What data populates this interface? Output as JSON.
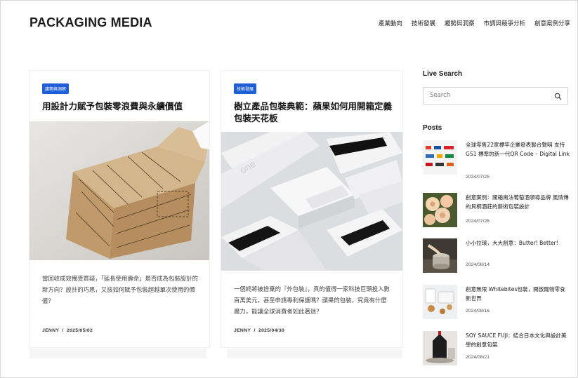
{
  "header": {
    "logo": "PACKAGING MEDIA",
    "nav": [
      "產業動向",
      "技術發展",
      "趨勢與洞察",
      "市調與競爭分析",
      "創意案例分享"
    ]
  },
  "cards": [
    {
      "tag": "趨勢與洞察",
      "title": "用設計力賦予包裝零浪費與永續價值",
      "excerpt": "當回收成效備受質疑，「延長使用壽命」是否成為包裝設計的新方向？設計的巧思，又該如何賦予包裝超越單次使用的價值？",
      "author": "JENNY",
      "date": "2025/05/02"
    },
    {
      "tag": "技術發展",
      "title": "樹立產品包裝典範：蘋果如何用開箱定義包裝天花板",
      "excerpt": "一個終將被捨棄的『外包裝』，真的值得一家科技巨頭投入數百萬美元，甚至申請專利保護嗎？蘋果的包裝，究竟有什麼魔力，能讓全球消費者如此著迷？",
      "author": "JENNY",
      "date": "2025/04/30"
    }
  ],
  "sidebar": {
    "live_search_heading": "Live Search",
    "search_placeholder": "Search",
    "posts_heading": "Posts",
    "posts": [
      {
        "title": "全球零售22家標竿企業發表聯合聲明 支持GS1 標準的新一代QR Code – Digital Link",
        "date": "2024/07/25",
        "thumb": "qr-logos"
      },
      {
        "title": "創意案例：開箱南法葡萄酒領導品牌 風情傳的貝桐酒莊的藝術包裝設計",
        "date": "2024/07/26",
        "thumb": "roses"
      },
      {
        "title": "小小拉環，大大創意：Butter! Better!",
        "date": "2024/08/14",
        "thumb": "butter-can"
      },
      {
        "title": "創意無限 Whitebites包裝，開啟寵物零食新世界",
        "date": "2024/08/16",
        "thumb": "pet-snack"
      },
      {
        "title": "SOY SAUCE FUJI：結合日本文化與設計美學的創意包裝",
        "date": "2024/08/21",
        "thumb": "soy-sauce"
      }
    ]
  }
}
